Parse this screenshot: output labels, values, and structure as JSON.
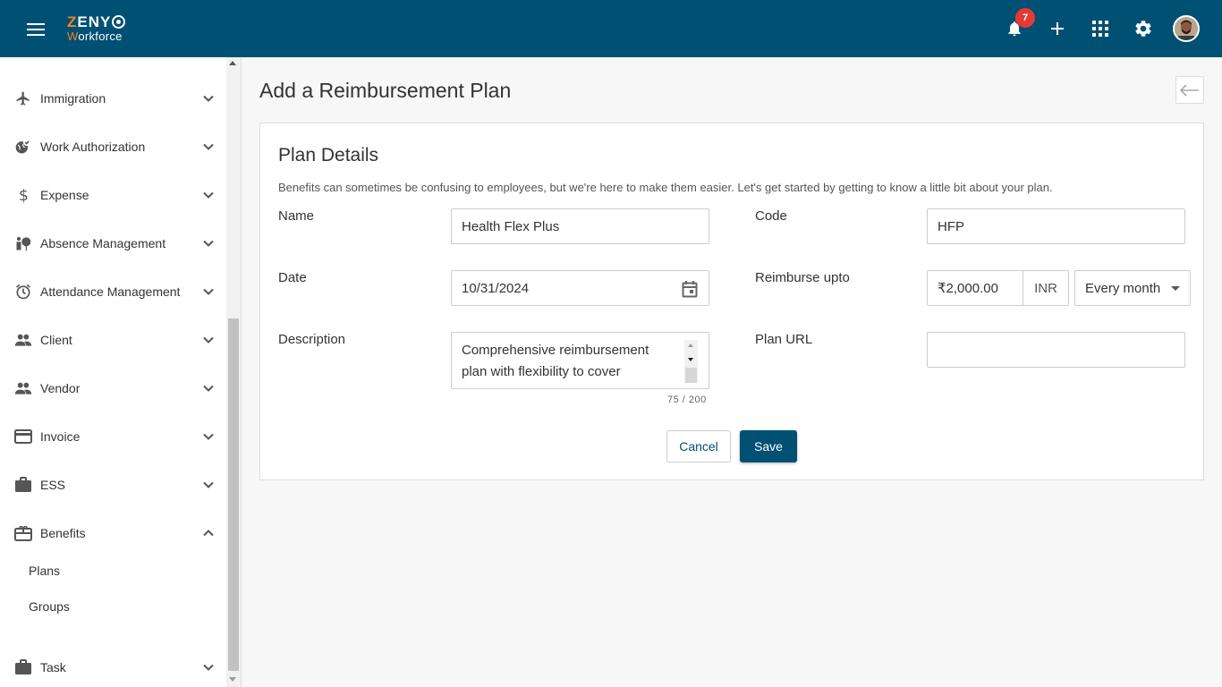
{
  "topbar": {
    "logo_main": "ZENY",
    "logo_first": "Z",
    "logo_sub_first": "W",
    "logo_sub_rest": "orkforce",
    "notification_count": "7"
  },
  "sidebar": {
    "items": [
      {
        "label": "Immigration",
        "icon": "airplane-icon"
      },
      {
        "label": "Work Authorization",
        "icon": "globe-check-icon"
      },
      {
        "label": "Expense",
        "icon": "dollar-icon"
      },
      {
        "label": "Absence Management",
        "icon": "person-umbrella-icon"
      },
      {
        "label": "Attendance Management",
        "icon": "alarm-clock-icon"
      },
      {
        "label": "Client",
        "icon": "people-icon"
      },
      {
        "label": "Vendor",
        "icon": "people-icon"
      },
      {
        "label": "Invoice",
        "icon": "credit-card-icon"
      },
      {
        "label": "ESS",
        "icon": "briefcase-icon"
      },
      {
        "label": "Benefits",
        "icon": "gift-card-icon"
      },
      {
        "label": "Task",
        "icon": "briefcase-icon"
      }
    ],
    "benefits_sub": [
      "Plans",
      "Groups"
    ]
  },
  "page": {
    "title": "Add a Reimbursement Plan"
  },
  "form": {
    "section_title": "Plan Details",
    "section_desc": "Benefits can sometimes be confusing to employees, but we're here to make them easier. Let's get started by getting to know a little bit about your plan.",
    "name_label": "Name",
    "name_value": "Health Flex Plus",
    "code_label": "Code",
    "code_value": "HFP",
    "date_label": "Date",
    "date_value": "10/31/2024",
    "reimburse_label": "Reimburse upto",
    "amount_value": "₹2,000.00",
    "currency": "INR",
    "frequency": "Every month",
    "description_label": "Description",
    "description_value": "Comprehensive reimbursement plan with flexibility to cover",
    "char_count": "75 / 200",
    "url_label": "Plan URL",
    "url_value": "",
    "cancel_label": "Cancel",
    "save_label": "Save"
  },
  "colors": {
    "primary": "#005073",
    "accent": "#f5821f",
    "badge": "#e53935"
  }
}
